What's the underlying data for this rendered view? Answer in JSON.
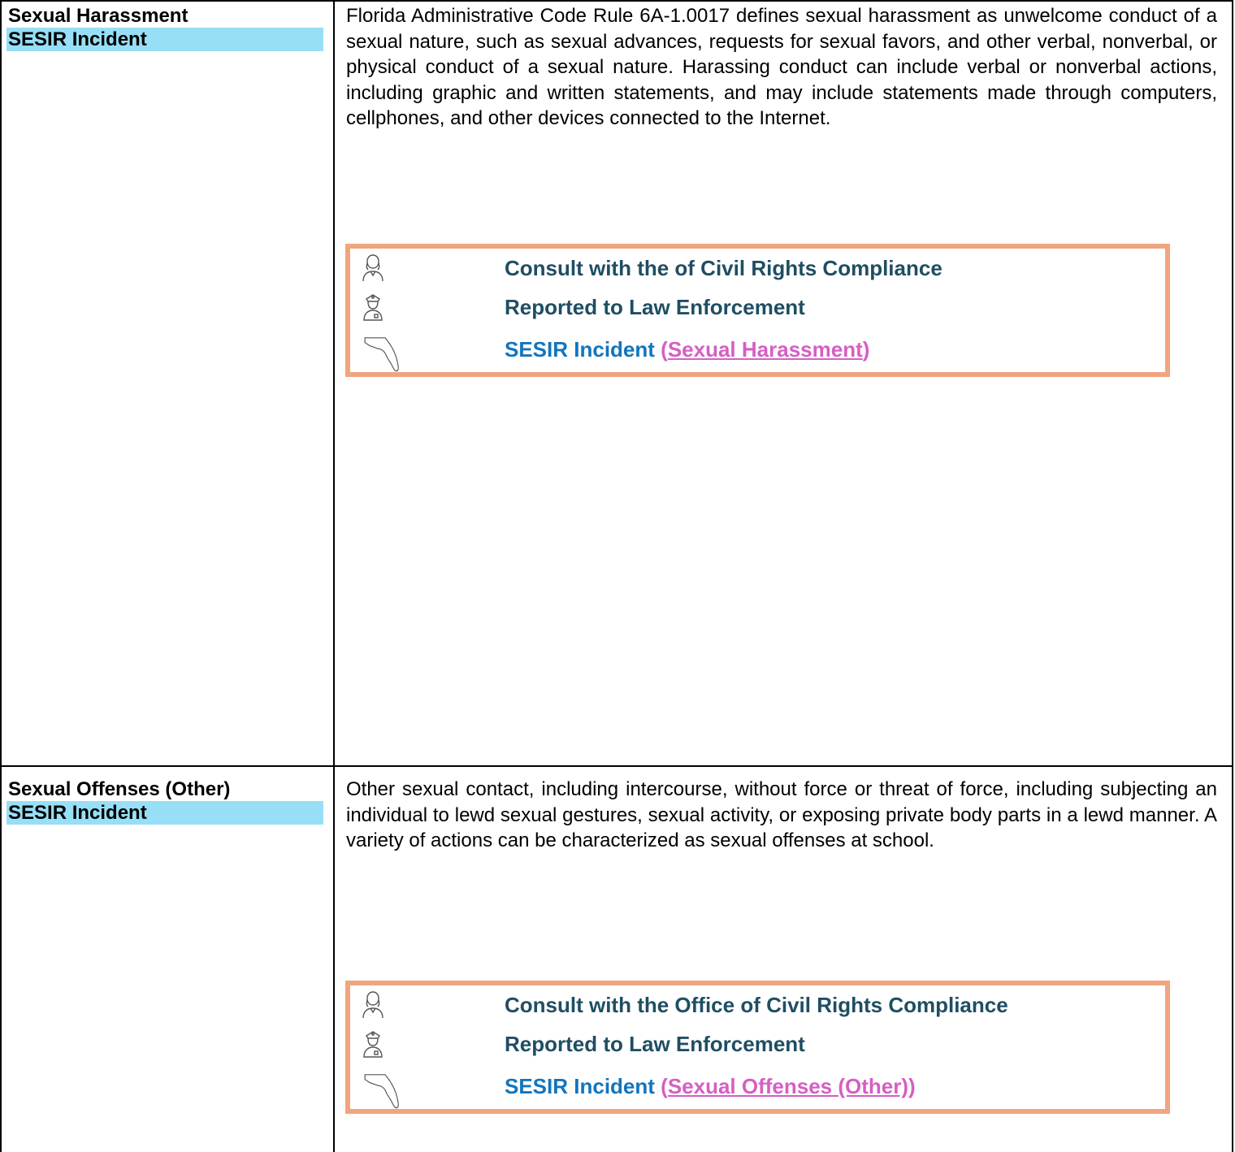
{
  "rows": [
    {
      "term": "Sexual Harassment",
      "tag": "SESIR Incident",
      "definition": "Florida Administrative Code Rule 6A-1.0017 defines sexual harassment as unwelcome conduct of a sexual nature, such as sexual advances, requests for sexual favors, and other verbal, nonverbal, or physical conduct of a sexual nature. Harassing conduct can include verbal or nonverbal actions, including graphic and written statements, and may include statements made through computers, cellphones, and other devices connected to the Internet.",
      "actions": {
        "consult": "Consult with the of Civil Rights Compliance",
        "report": "Reported to Law Enforcement",
        "sesir_label": "SESIR Incident",
        "sesir_open": "(",
        "sesir_link": "Sexual Harassment",
        "sesir_close": ")"
      }
    },
    {
      "term": "Sexual Offenses (Other)",
      "tag": "SESIR Incident",
      "definition": "Other sexual contact, including intercourse, without force or threat of force, including subjecting an individual to lewd sexual gestures, sexual activity, or exposing private body parts in a lewd manner.  A variety of actions can be characterized as sexual offenses at school.",
      "actions": {
        "consult": "Consult with the Office of Civil Rights Compliance",
        "report": "Reported to Law Enforcement",
        "sesir_label": "SESIR Incident",
        "sesir_open": "(",
        "sesir_link": "Sexual Offenses (Other)",
        "sesir_close": ")"
      }
    }
  ],
  "icons": {
    "consult": "person-icon",
    "report": "police-officer-icon",
    "sesir": "florida-map-icon"
  },
  "colors": {
    "tag_highlight": "#97DFF6",
    "box_border": "#F0A57F",
    "action_text": "#1F4E63",
    "sesir_text": "#1275BE",
    "link_text": "#D55FC3"
  }
}
